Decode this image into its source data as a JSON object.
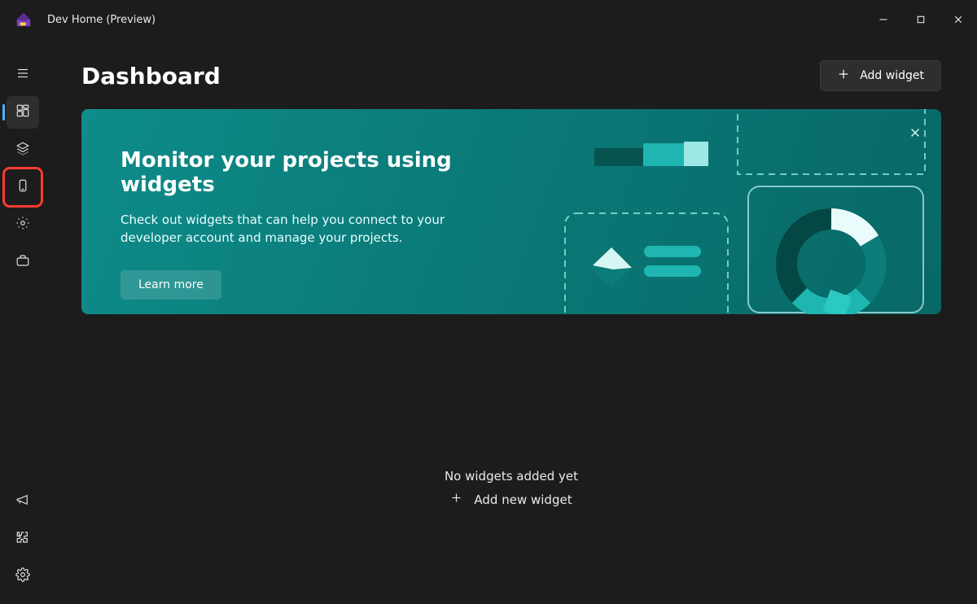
{
  "app": {
    "title": "Dev Home (Preview)"
  },
  "header": {
    "title": "Dashboard",
    "add_widget_label": "Add widget"
  },
  "sidebar": {
    "items": [
      {
        "name": "hamburger"
      },
      {
        "name": "dashboard"
      },
      {
        "name": "layers"
      },
      {
        "name": "device"
      },
      {
        "name": "manage"
      },
      {
        "name": "toolbox"
      }
    ],
    "bottom_items": [
      {
        "name": "feedback"
      },
      {
        "name": "extensions"
      },
      {
        "name": "settings"
      }
    ]
  },
  "banner": {
    "title": "Monitor your projects using widgets",
    "description": "Check out widgets that can help you connect to your developer account and manage your projects.",
    "learn_more_label": "Learn more"
  },
  "empty_state": {
    "title": "No widgets added yet",
    "action_label": "Add new widget"
  }
}
